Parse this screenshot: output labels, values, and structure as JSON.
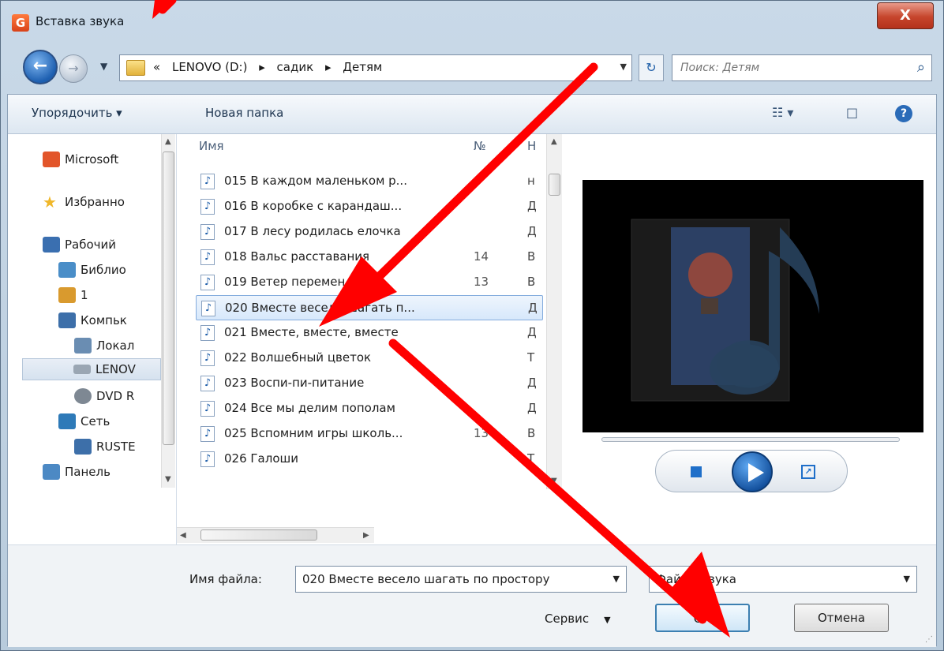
{
  "window": {
    "title": "Вставка звука",
    "app_icon_glyph": "G",
    "close_glyph": "X"
  },
  "address": {
    "crumbs": [
      "«",
      "LENOVO (D:)",
      "▸",
      "садик",
      "▸",
      "Детям"
    ],
    "search_placeholder": "Поиск: Детям"
  },
  "toolbar": {
    "organize": "Упорядочить ▾",
    "new_folder": "Новая папка"
  },
  "nav": {
    "items": [
      {
        "label": "Microsoft",
        "icon": "office-icon",
        "color": "#e2552a"
      },
      {
        "label": "Избранно",
        "icon": "star-icon",
        "color": "#f0b72a"
      },
      {
        "label": "Рабочий",
        "icon": "desktop-icon",
        "color": "#3a6fb0"
      },
      {
        "label": "Библио",
        "icon": "library-icon",
        "color": "#4a8ec8"
      },
      {
        "label": "1",
        "icon": "user-icon",
        "color": "#d99a2e"
      },
      {
        "label": "Компьк",
        "icon": "computer-icon",
        "color": "#3d6fa9"
      },
      {
        "label": "Локал",
        "icon": "drive-icon",
        "color": "#6a8db2"
      },
      {
        "label": "LENOV",
        "icon": "drive-icon",
        "color": "#9aa6b3"
      },
      {
        "label": "DVD R",
        "icon": "dvd-icon",
        "color": "#7e8893"
      },
      {
        "label": "Сеть",
        "icon": "network-icon",
        "color": "#2e7ab8"
      },
      {
        "label": "RUSTE",
        "icon": "computer-icon",
        "color": "#3d6fa9"
      },
      {
        "label": "Панель",
        "icon": "control-panel-icon",
        "color": "#4c89c4"
      }
    ]
  },
  "columns": {
    "name": "Имя",
    "num": "№",
    "h": "Н"
  },
  "files": [
    {
      "name": "015 В каждом маленьком р...",
      "num": "",
      "h": "н"
    },
    {
      "name": "016 В коробке с карандаш...",
      "num": "",
      "h": "Д"
    },
    {
      "name": "017 В лесу родилась елочка",
      "num": "",
      "h": "Д"
    },
    {
      "name": "018 Вальс расставания",
      "num": "14",
      "h": "В"
    },
    {
      "name": "019 Ветер перемен",
      "num": "13",
      "h": "В"
    },
    {
      "name": "020 Вместе весело шагать п...",
      "num": "",
      "h": "Д"
    },
    {
      "name": "021 Вместе, вместе, вместе",
      "num": "",
      "h": "Д"
    },
    {
      "name": "022 Волшебный цветок",
      "num": "",
      "h": "Т"
    },
    {
      "name": "023 Воспи-пи-питание",
      "num": "",
      "h": "Д"
    },
    {
      "name": "024 Все мы делим пополам",
      "num": "",
      "h": "Д"
    },
    {
      "name": "025 Вспомним игры школь...",
      "num": "13",
      "h": "В"
    },
    {
      "name": "026 Галоши",
      "num": "",
      "h": "Т"
    }
  ],
  "selected_file_index": 5,
  "bottom": {
    "filename_label": "Имя файла:",
    "filename_value": "020 Вместе весело шагать по простору",
    "filetype_value": "Файлы звука",
    "service": "Сервис",
    "ok": "ОК",
    "cancel": "Отмена"
  },
  "colors": {
    "accent": "#1f6fc9",
    "annotation_arrow": "#ff0000",
    "selection": "#d7e8fb"
  }
}
